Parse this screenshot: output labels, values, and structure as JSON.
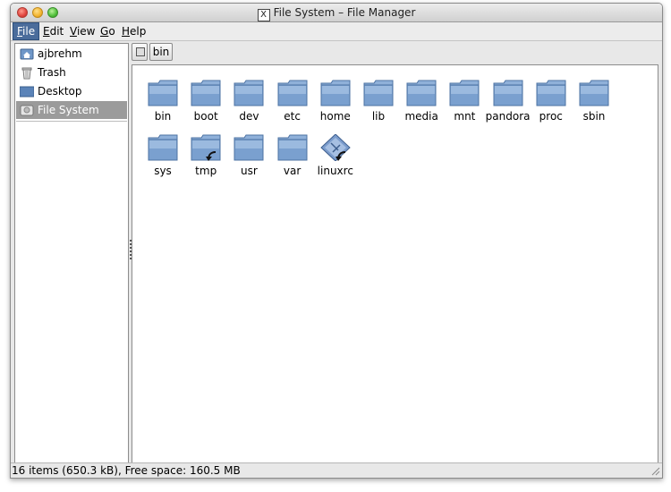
{
  "window": {
    "title": "File System – File Manager"
  },
  "menubar": [
    {
      "label": "File",
      "active": true
    },
    {
      "label": "Edit",
      "active": false
    },
    {
      "label": "View",
      "active": false
    },
    {
      "label": "Go",
      "active": false
    },
    {
      "label": "Help",
      "active": false
    }
  ],
  "sidebar": {
    "items": [
      {
        "label": "ajbrehm",
        "icon": "home-folder-icon"
      },
      {
        "label": "Trash",
        "icon": "trash-icon"
      },
      {
        "label": "Desktop",
        "icon": "desktop-icon"
      },
      {
        "label": "File System",
        "icon": "drive-icon",
        "selected": true
      }
    ]
  },
  "pathbar": {
    "current": "bin"
  },
  "files": [
    {
      "name": "bin",
      "kind": "folder"
    },
    {
      "name": "boot",
      "kind": "folder"
    },
    {
      "name": "dev",
      "kind": "folder"
    },
    {
      "name": "etc",
      "kind": "folder"
    },
    {
      "name": "home",
      "kind": "folder"
    },
    {
      "name": "lib",
      "kind": "folder"
    },
    {
      "name": "media",
      "kind": "folder"
    },
    {
      "name": "mnt",
      "kind": "folder"
    },
    {
      "name": "pandora",
      "kind": "folder"
    },
    {
      "name": "proc",
      "kind": "folder"
    },
    {
      "name": "sbin",
      "kind": "folder"
    },
    {
      "name": "sys",
      "kind": "folder"
    },
    {
      "name": "tmp",
      "kind": "folder-link"
    },
    {
      "name": "usr",
      "kind": "folder"
    },
    {
      "name": "var",
      "kind": "folder"
    },
    {
      "name": "linuxrc",
      "kind": "executable-link"
    }
  ],
  "status": {
    "text": "16 items (650.3 kB), Free space: 160.5 MB"
  },
  "colors": {
    "accent": "#4a6c9b",
    "folder": "#6f97c8",
    "selection": "#9b9b9b"
  }
}
